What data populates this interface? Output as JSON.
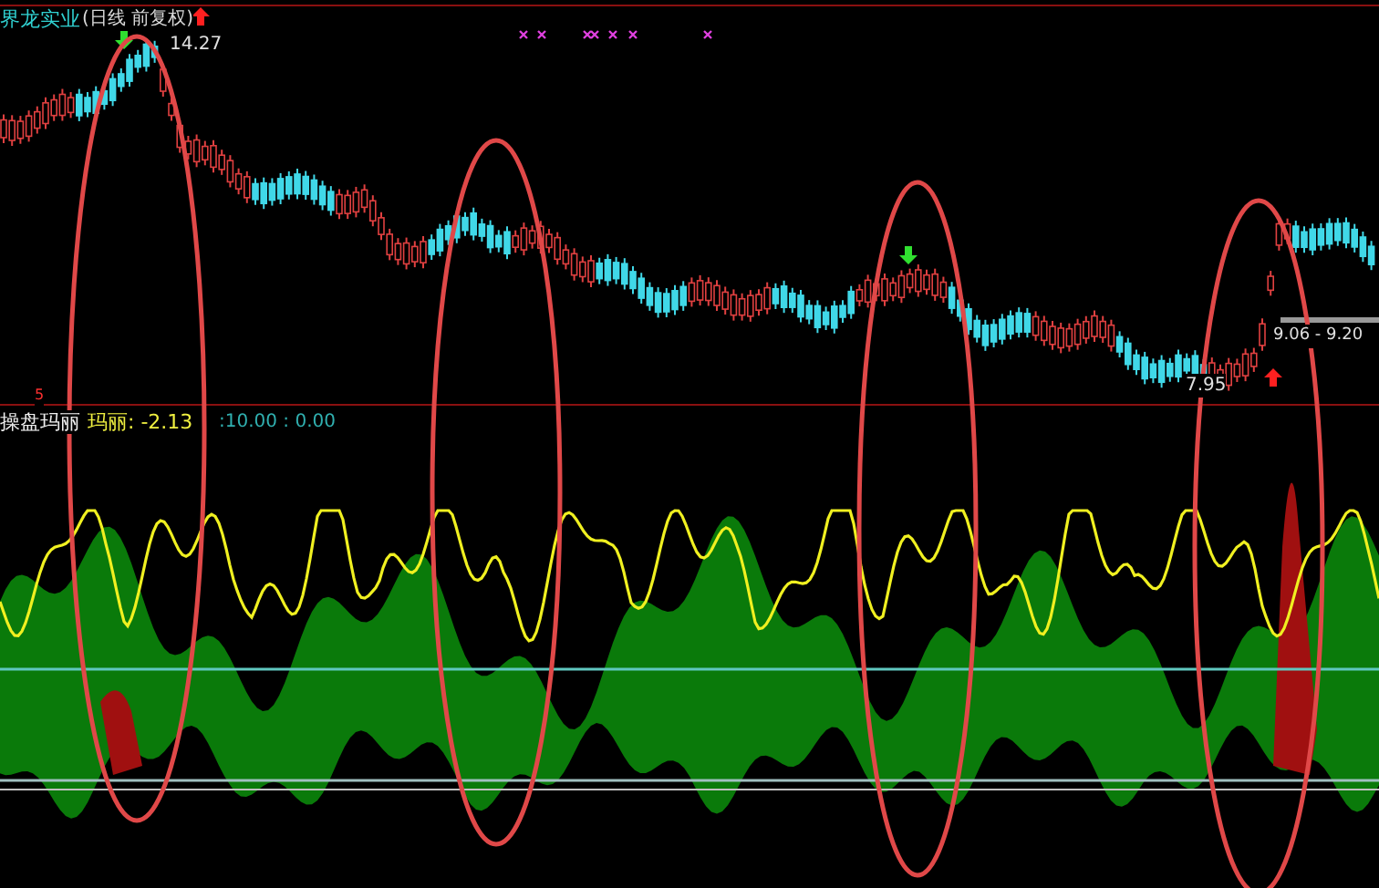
{
  "price_panel": {
    "stock_name": "界龙实业",
    "period": "(日线 前复权)",
    "high_label": "14.27",
    "low_label": "7.95",
    "range_label": "9.06 - 9.20",
    "marker": "5"
  },
  "indicator_panel": {
    "name": "操盘玛丽",
    "value_label": "玛丽: -2.13",
    "levels": ":10.00 : 0.00"
  }
}
